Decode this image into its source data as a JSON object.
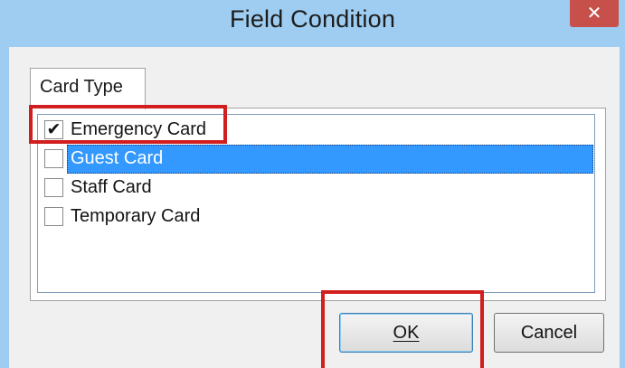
{
  "dialog": {
    "title": "Field Condition",
    "close_glyph": "✕"
  },
  "tabs": [
    {
      "label": "Card Type",
      "active": true
    }
  ],
  "list": {
    "items": [
      {
        "label": "Emergency Card",
        "checked": true,
        "selected": false,
        "check_glyph": "✔"
      },
      {
        "label": "Guest Card",
        "checked": false,
        "selected": true,
        "check_glyph": ""
      },
      {
        "label": "Staff Card",
        "checked": false,
        "selected": false,
        "check_glyph": ""
      },
      {
        "label": "Temporary Card",
        "checked": false,
        "selected": false,
        "check_glyph": ""
      }
    ]
  },
  "buttons": {
    "ok_label": "OK",
    "ok_access_key": "O",
    "cancel_label": "Cancel",
    "cancel_access_key": "C"
  },
  "colors": {
    "titlebar": "#9ecdf1",
    "selection": "#3399ff",
    "annotation": "#d11f1f",
    "close": "#c7504b"
  }
}
